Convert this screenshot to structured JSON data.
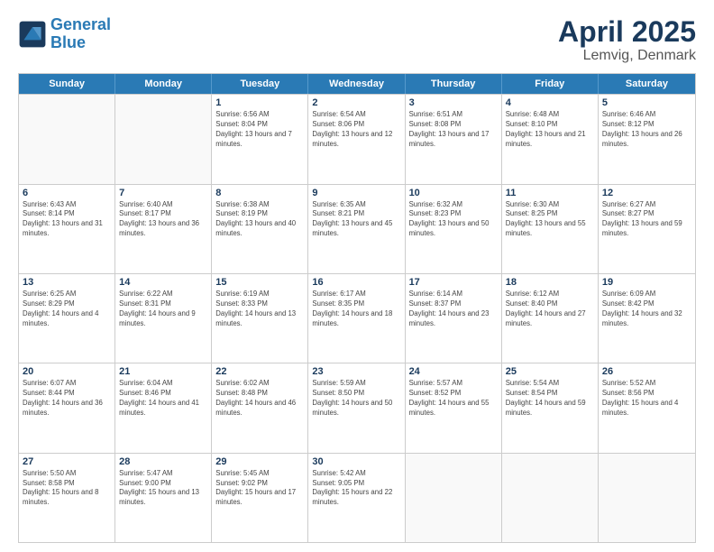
{
  "logo": {
    "line1": "General",
    "line2": "Blue"
  },
  "title": "April 2025",
  "subtitle": "Lemvig, Denmark",
  "header_days": [
    "Sunday",
    "Monday",
    "Tuesday",
    "Wednesday",
    "Thursday",
    "Friday",
    "Saturday"
  ],
  "weeks": [
    [
      {
        "day": "",
        "text": ""
      },
      {
        "day": "",
        "text": ""
      },
      {
        "day": "1",
        "text": "Sunrise: 6:56 AM\nSunset: 8:04 PM\nDaylight: 13 hours and 7 minutes."
      },
      {
        "day": "2",
        "text": "Sunrise: 6:54 AM\nSunset: 8:06 PM\nDaylight: 13 hours and 12 minutes."
      },
      {
        "day": "3",
        "text": "Sunrise: 6:51 AM\nSunset: 8:08 PM\nDaylight: 13 hours and 17 minutes."
      },
      {
        "day": "4",
        "text": "Sunrise: 6:48 AM\nSunset: 8:10 PM\nDaylight: 13 hours and 21 minutes."
      },
      {
        "day": "5",
        "text": "Sunrise: 6:46 AM\nSunset: 8:12 PM\nDaylight: 13 hours and 26 minutes."
      }
    ],
    [
      {
        "day": "6",
        "text": "Sunrise: 6:43 AM\nSunset: 8:14 PM\nDaylight: 13 hours and 31 minutes."
      },
      {
        "day": "7",
        "text": "Sunrise: 6:40 AM\nSunset: 8:17 PM\nDaylight: 13 hours and 36 minutes."
      },
      {
        "day": "8",
        "text": "Sunrise: 6:38 AM\nSunset: 8:19 PM\nDaylight: 13 hours and 40 minutes."
      },
      {
        "day": "9",
        "text": "Sunrise: 6:35 AM\nSunset: 8:21 PM\nDaylight: 13 hours and 45 minutes."
      },
      {
        "day": "10",
        "text": "Sunrise: 6:32 AM\nSunset: 8:23 PM\nDaylight: 13 hours and 50 minutes."
      },
      {
        "day": "11",
        "text": "Sunrise: 6:30 AM\nSunset: 8:25 PM\nDaylight: 13 hours and 55 minutes."
      },
      {
        "day": "12",
        "text": "Sunrise: 6:27 AM\nSunset: 8:27 PM\nDaylight: 13 hours and 59 minutes."
      }
    ],
    [
      {
        "day": "13",
        "text": "Sunrise: 6:25 AM\nSunset: 8:29 PM\nDaylight: 14 hours and 4 minutes."
      },
      {
        "day": "14",
        "text": "Sunrise: 6:22 AM\nSunset: 8:31 PM\nDaylight: 14 hours and 9 minutes."
      },
      {
        "day": "15",
        "text": "Sunrise: 6:19 AM\nSunset: 8:33 PM\nDaylight: 14 hours and 13 minutes."
      },
      {
        "day": "16",
        "text": "Sunrise: 6:17 AM\nSunset: 8:35 PM\nDaylight: 14 hours and 18 minutes."
      },
      {
        "day": "17",
        "text": "Sunrise: 6:14 AM\nSunset: 8:37 PM\nDaylight: 14 hours and 23 minutes."
      },
      {
        "day": "18",
        "text": "Sunrise: 6:12 AM\nSunset: 8:40 PM\nDaylight: 14 hours and 27 minutes."
      },
      {
        "day": "19",
        "text": "Sunrise: 6:09 AM\nSunset: 8:42 PM\nDaylight: 14 hours and 32 minutes."
      }
    ],
    [
      {
        "day": "20",
        "text": "Sunrise: 6:07 AM\nSunset: 8:44 PM\nDaylight: 14 hours and 36 minutes."
      },
      {
        "day": "21",
        "text": "Sunrise: 6:04 AM\nSunset: 8:46 PM\nDaylight: 14 hours and 41 minutes."
      },
      {
        "day": "22",
        "text": "Sunrise: 6:02 AM\nSunset: 8:48 PM\nDaylight: 14 hours and 46 minutes."
      },
      {
        "day": "23",
        "text": "Sunrise: 5:59 AM\nSunset: 8:50 PM\nDaylight: 14 hours and 50 minutes."
      },
      {
        "day": "24",
        "text": "Sunrise: 5:57 AM\nSunset: 8:52 PM\nDaylight: 14 hours and 55 minutes."
      },
      {
        "day": "25",
        "text": "Sunrise: 5:54 AM\nSunset: 8:54 PM\nDaylight: 14 hours and 59 minutes."
      },
      {
        "day": "26",
        "text": "Sunrise: 5:52 AM\nSunset: 8:56 PM\nDaylight: 15 hours and 4 minutes."
      }
    ],
    [
      {
        "day": "27",
        "text": "Sunrise: 5:50 AM\nSunset: 8:58 PM\nDaylight: 15 hours and 8 minutes."
      },
      {
        "day": "28",
        "text": "Sunrise: 5:47 AM\nSunset: 9:00 PM\nDaylight: 15 hours and 13 minutes."
      },
      {
        "day": "29",
        "text": "Sunrise: 5:45 AM\nSunset: 9:02 PM\nDaylight: 15 hours and 17 minutes."
      },
      {
        "day": "30",
        "text": "Sunrise: 5:42 AM\nSunset: 9:05 PM\nDaylight: 15 hours and 22 minutes."
      },
      {
        "day": "",
        "text": ""
      },
      {
        "day": "",
        "text": ""
      },
      {
        "day": "",
        "text": ""
      }
    ]
  ]
}
